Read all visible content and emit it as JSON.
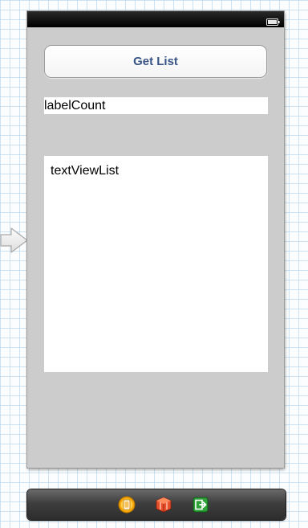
{
  "scene": {
    "get_list_button_label": "Get List",
    "label_count_text": "labelCount",
    "text_view_list_text": "textViewList"
  },
  "colors": {
    "view_background": "#cccccc",
    "button_text": "#385487",
    "canvas_grid": "#aacde6",
    "dock_background": "#3e3e3e"
  },
  "icons": {
    "entry_arrow": "initial-view-controller-arrow-icon",
    "status_bar_battery": "battery-icon",
    "dock": [
      "view-controller-icon",
      "first-responder-cube-icon",
      "exit-icon"
    ]
  }
}
